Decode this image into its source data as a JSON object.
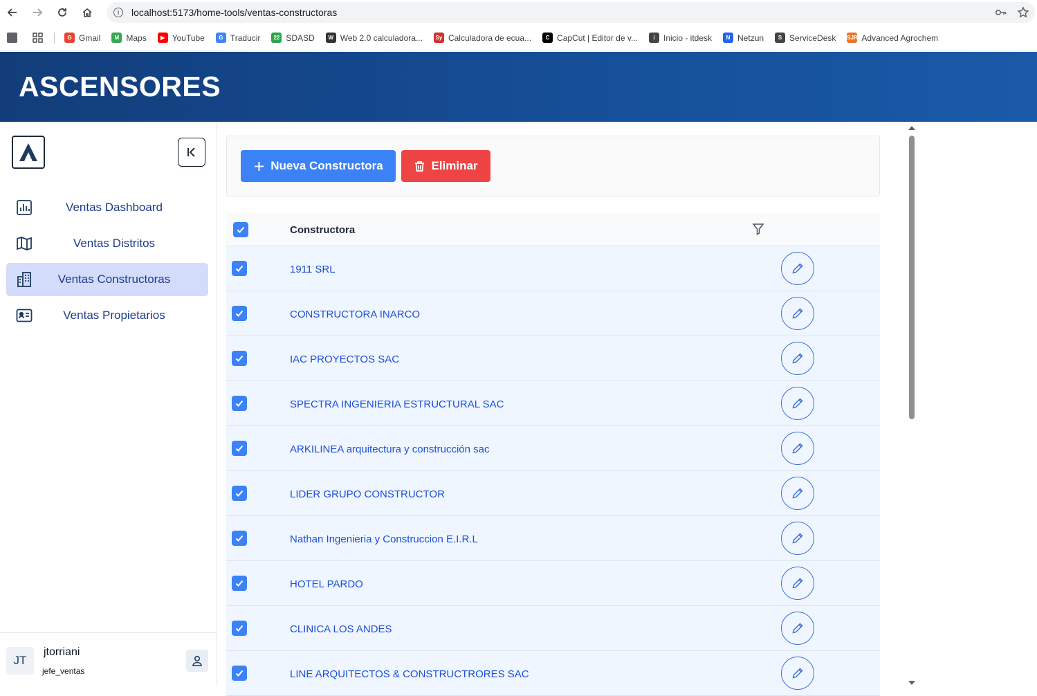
{
  "browser": {
    "url": "localhost:5173/home-tools/ventas-constructoras",
    "bookmarks": [
      {
        "label": "Gmail",
        "color": "#ea4335",
        "icon": "G"
      },
      {
        "label": "Maps",
        "color": "#34a853",
        "icon": "M"
      },
      {
        "label": "YouTube",
        "color": "#ff0000",
        "icon": "▶"
      },
      {
        "label": "Traducir",
        "color": "#4285f4",
        "icon": "G"
      },
      {
        "label": "SDASD",
        "color": "#2da44e",
        "icon": "22"
      },
      {
        "label": "Web 2.0 calculadora...",
        "color": "#333333",
        "icon": "W"
      },
      {
        "label": "Calculadora de ecua...",
        "color": "#d32f2f",
        "icon": "Sy"
      },
      {
        "label": "CapCut | Editor de v...",
        "color": "#000000",
        "icon": "C"
      },
      {
        "label": "Inicio - itdesk",
        "color": "#444444",
        "icon": "i"
      },
      {
        "label": "Netzun",
        "color": "#2563eb",
        "icon": "N"
      },
      {
        "label": "ServiceDesk",
        "color": "#444444",
        "icon": "S"
      },
      {
        "label": "Advanced Agrochem",
        "color": "#e8762d",
        "icon": "SJR"
      }
    ]
  },
  "header": {
    "title": "ASCENSORES"
  },
  "sidebar": {
    "items": [
      {
        "label": "Ventas Dashboard",
        "icon": "bar-chart-icon"
      },
      {
        "label": "Ventas Distritos",
        "icon": "map-icon"
      },
      {
        "label": "Ventas Constructoras",
        "icon": "building-icon",
        "active": true
      },
      {
        "label": "Ventas Propietarios",
        "icon": "id-card-icon"
      }
    ],
    "user": {
      "initials": "JT",
      "name": "jtorriani",
      "role": "jefe_ventas"
    }
  },
  "toolbar": {
    "new_label": "Nueva Constructora",
    "delete_label": "Eliminar",
    "new_color": "#3b82f6",
    "delete_color": "#ef4444"
  },
  "table": {
    "column_header": "Constructora",
    "rows": [
      "1911 SRL",
      "CONSTRUCTORA INARCO",
      "IAC PROYECTOS SAC",
      "SPECTRA INGENIERIA ESTRUCTURAL SAC",
      "ARKILINEA arquitectura y construcción sac",
      "LIDER GRUPO CONSTRUCTOR",
      "Nathan Ingenieria y Construccion E.I.R.L",
      "HOTEL PARDO",
      "CLINICA LOS ANDES",
      "LINE ARQUITECTOS & CONSTRUCTRORES SAC"
    ],
    "all_selected": true
  }
}
